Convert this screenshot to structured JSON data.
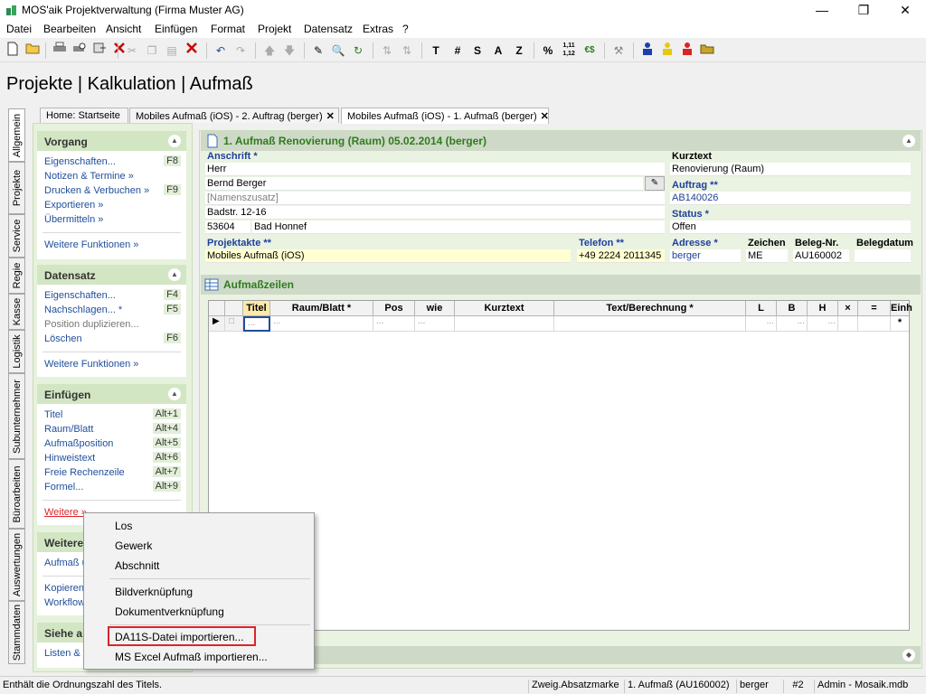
{
  "window": {
    "title": "MOS'aik Projektverwaltung (Firma Muster AG)"
  },
  "menu": [
    "Datei",
    "Bearbeiten",
    "Ansicht",
    "Einfügen",
    "Format",
    "Projekt",
    "Datensatz",
    "Extras",
    "?"
  ],
  "toolbar": {
    "text_buttons": [
      "T",
      "#",
      "S",
      "A",
      "Z",
      "%",
      "1,11 1,12",
      "€$"
    ]
  },
  "page_heading": "Projekte | Kalkulation | Aufmaß",
  "doc_tabs": [
    "Home: Startseite",
    "Mobiles Aufmaß (iOS) - 2. Auftrag (berger)",
    "Mobiles Aufmaß (iOS) - 1. Aufmaß (berger)"
  ],
  "vertical_tabs": [
    "Allgemein",
    "Projekte",
    "Service",
    "Regie",
    "Kasse",
    "Logistik",
    "Subunternehmer",
    "Büroarbeiten",
    "Auswertungen",
    "Stammdaten"
  ],
  "left_pane": {
    "vorgang": {
      "title": "Vorgang",
      "items": [
        {
          "label": "Eigenschaften...",
          "key": "F8"
        },
        {
          "label": "Notizen & Termine »",
          "key": ""
        },
        {
          "label": "Drucken & Verbuchen »",
          "key": "F9"
        },
        {
          "label": "Exportieren »",
          "key": ""
        },
        {
          "label": "Übermitteln »",
          "key": ""
        }
      ],
      "more": "Weitere Funktionen »"
    },
    "datensatz": {
      "title": "Datensatz",
      "items": [
        {
          "label": "Eigenschaften...",
          "key": "F4"
        },
        {
          "label": "Nachschlagen... *",
          "key": "F5"
        },
        {
          "label": "Position duplizieren...",
          "key": ""
        },
        {
          "label": "Löschen",
          "key": "F6"
        }
      ],
      "more": "Weitere Funktionen »"
    },
    "einfuegen": {
      "title": "Einfügen",
      "items": [
        {
          "label": "Titel",
          "key": "Alt+1"
        },
        {
          "label": "Raum/Blatt",
          "key": "Alt+4"
        },
        {
          "label": "Aufmaßposition",
          "key": "Alt+5"
        },
        {
          "label": "Hinweistext",
          "key": "Alt+6"
        },
        {
          "label": "Freie Rechenzeile",
          "key": "Alt+7"
        },
        {
          "label": "Formel...",
          "key": "Alt+9"
        }
      ],
      "more": "Weitere »"
    },
    "weitere": {
      "title": "Weitere",
      "items": [
        "Aufmaß ü",
        "Kopieren",
        "Workflow"
      ]
    },
    "siehe": {
      "title": "Siehe a",
      "items": [
        "Listen & S"
      ]
    }
  },
  "record": {
    "header": "1. Aufmaß Renovierung (Raum) 05.02.2014 (berger)",
    "anschrift_label": "Anschrift *",
    "address": [
      "Herr",
      "Bernd Berger",
      "[Namenszusatz]",
      "Badstr. 12-16"
    ],
    "plz": "53604",
    "ort": "Bad Honnef",
    "kurztext_label": "Kurztext",
    "kurztext": "Renovierung (Raum)",
    "auftrag_label": "Auftrag **",
    "auftrag": "AB140026",
    "status_label": "Status *",
    "status": "Offen",
    "projektakte_label": "Projektakte **",
    "projektakte": "Mobiles Aufmaß (iOS)",
    "telefon_label": "Telefon **",
    "telefon": "+49 2224 2011345",
    "adresse_label": "Adresse *",
    "adresse": "berger",
    "zeichen_label": "Zeichen",
    "zeichen": "ME",
    "belegnr_label": "Beleg-Nr.",
    "belegnr": "AU160002",
    "belegdatum_label": "Belegdatum",
    "belegdatum": ""
  },
  "aufmass": {
    "header": "Aufmaßzeilen",
    "columns": [
      "Titel",
      "Raum/Blatt *",
      "Pos",
      "wie",
      "Kurztext",
      "Text/Berechnung *",
      "L",
      "B",
      "H",
      "×",
      "=",
      "Einh *"
    ],
    "row_placeholder": "..."
  },
  "context_menu": {
    "items": [
      "Los",
      "Gewerk",
      "Abschnitt",
      "Bildverknüpfung",
      "Dokumentverknüpfung",
      "DA11S-Datei importieren...",
      "MS Excel Aufmaß importieren..."
    ],
    "highlighted": "DA11S-Datei importieren..."
  },
  "status_bar": [
    "Enthält die Ordnungszahl des Titels.",
    "Zweig.Absatzmarke",
    "1. Aufmaß (AU160002)",
    "berger",
    "#2",
    "Admin - Mosaik.mdb"
  ],
  "colors": {
    "accent_green": "#2e7d1c",
    "link_blue": "#1f4e9b",
    "label_blue": "#1f3f9b",
    "highlight_red": "#d9262b"
  }
}
